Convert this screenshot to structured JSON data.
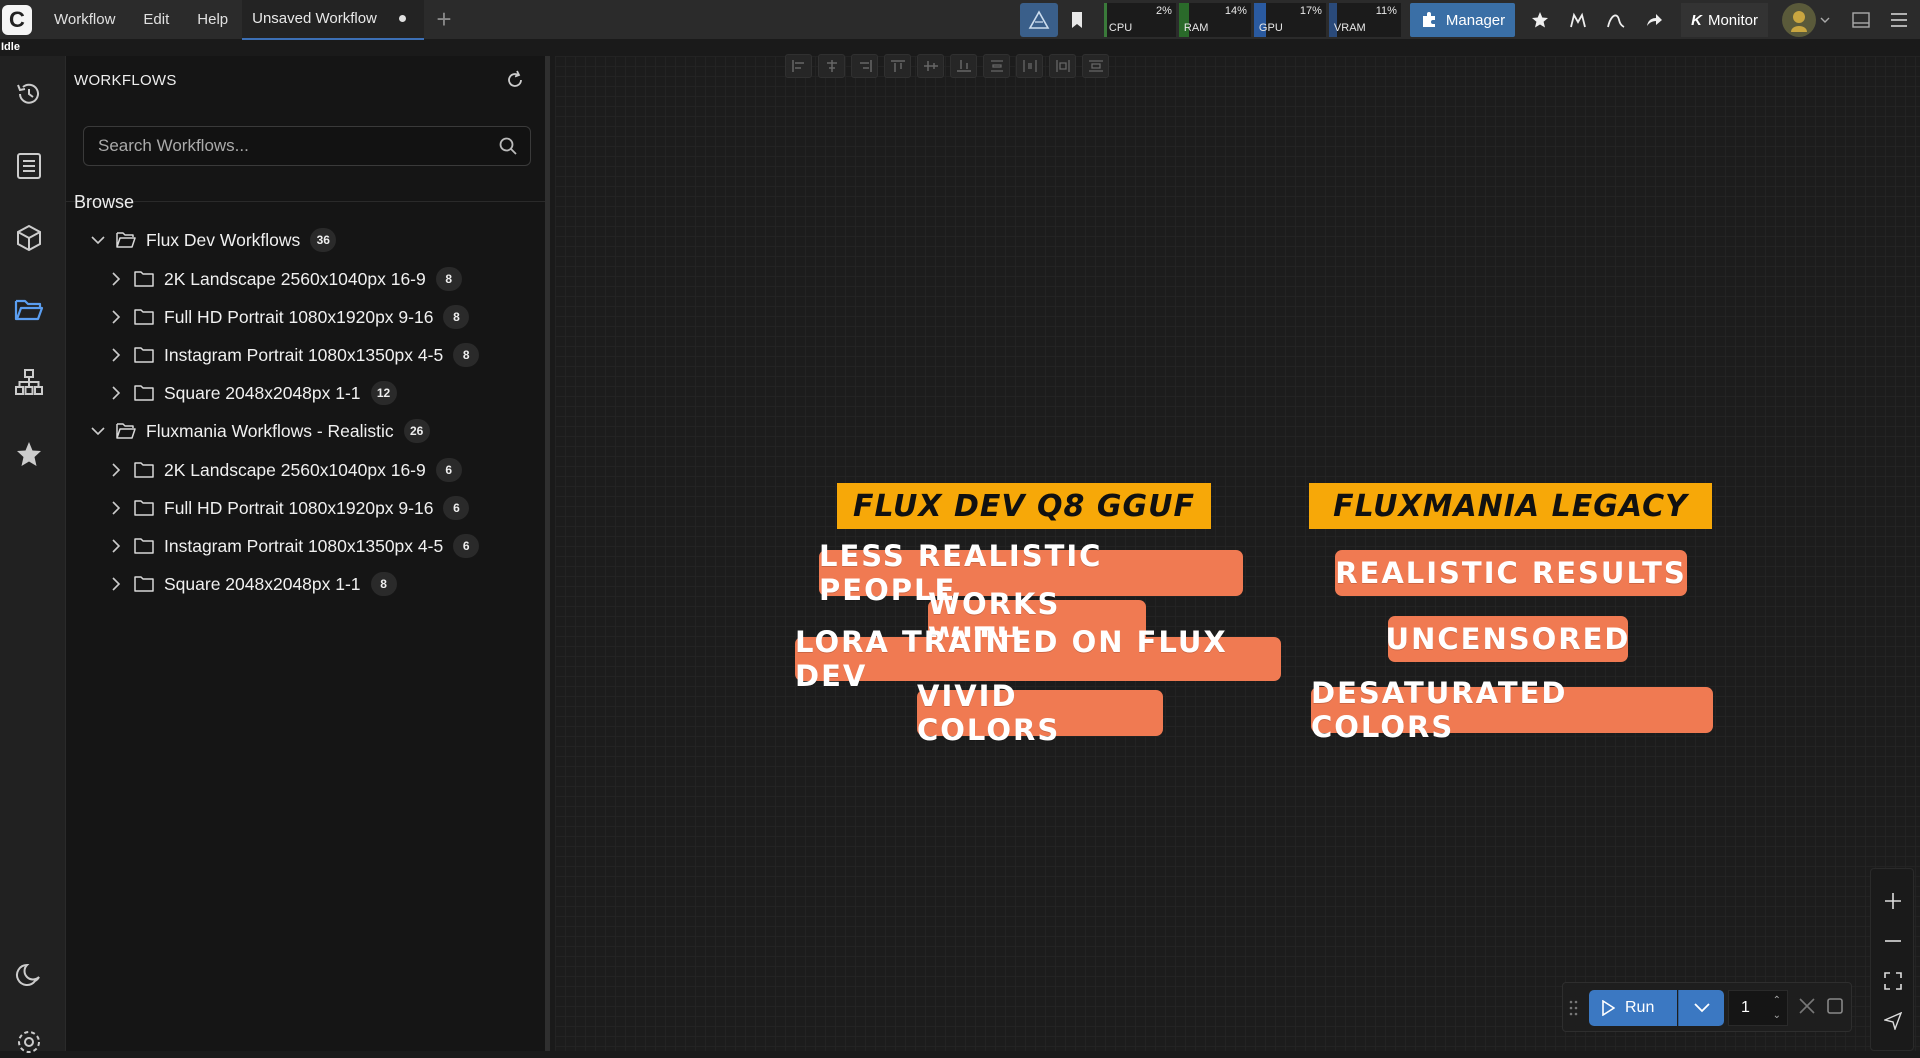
{
  "topbar": {
    "menu": [
      "Workflow",
      "Edit",
      "Help"
    ],
    "tab_title": "Unsaved Workflow",
    "meters": [
      {
        "label": "CPU",
        "value": "2%",
        "fraction": 0.02,
        "color": "#3a7a3a"
      },
      {
        "label": "RAM",
        "value": "14%",
        "fraction": 0.14,
        "color": "#2a6a2a"
      },
      {
        "label": "GPU",
        "value": "17%",
        "fraction": 0.17,
        "color": "#2a5aa0"
      },
      {
        "label": "VRAM",
        "value": "11%",
        "fraction": 0.11,
        "color": "#2a4a7a"
      }
    ],
    "manager_label": "Manager",
    "monitor_label": "Monitor",
    "monitor_prefix": "K"
  },
  "status": "Idle",
  "sidebar_panel": {
    "title": "WORKFLOWS",
    "search_placeholder": "Search Workflows...",
    "browse_label": "Browse",
    "groups": [
      {
        "name": "Flux Dev Workflows",
        "count": "36",
        "items": [
          {
            "name": "2K Landscape 2560x1040px 16-9",
            "count": "8"
          },
          {
            "name": "Full HD Portrait 1080x1920px 9-16",
            "count": "8"
          },
          {
            "name": "Instagram Portrait 1080x1350px 4-5",
            "count": "8"
          },
          {
            "name": "Square 2048x2048px 1-1",
            "count": "12"
          }
        ]
      },
      {
        "name": "Fluxmania Workflows - Realistic",
        "count": "26",
        "items": [
          {
            "name": "2K Landscape 2560x1040px 16-9",
            "count": "6"
          },
          {
            "name": "Full HD Portrait 1080x1920px 9-16",
            "count": "6"
          },
          {
            "name": "Instagram Portrait 1080x1350px 4-5",
            "count": "6"
          },
          {
            "name": "Square 2048x2048px 1-1",
            "count": "8"
          }
        ]
      }
    ]
  },
  "canvas": {
    "left_header": "FLUX DEV Q8 GGUF",
    "right_header": "FLUXMANIA LEGACY",
    "left_pills": [
      "LESS REALISTIC PEOPLE",
      "WORKS WITH",
      "LORA TRAINED ON FLUX DEV",
      "VIVID COLORS"
    ],
    "right_pills": [
      "REALISTIC RESULTS",
      "UNCENSORED",
      "DESATURATED COLORS"
    ]
  },
  "runbar": {
    "run_label": "Run",
    "batch_count": "1"
  },
  "colors": {
    "accent": "#3b78c2",
    "header_bg": "#f7a808",
    "pill_bg": "#f07a52"
  }
}
